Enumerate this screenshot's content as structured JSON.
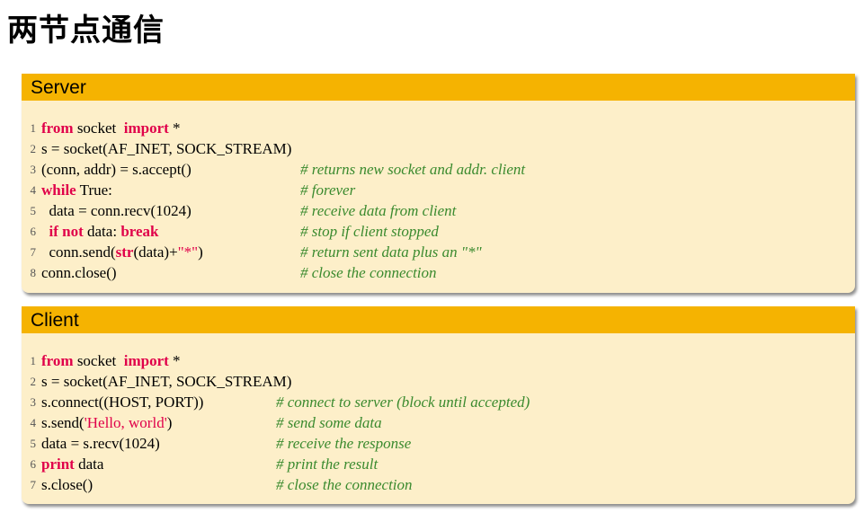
{
  "title": "两节点通信",
  "colors": {
    "header": "#f5b301",
    "body": "#fdefc9",
    "keyword": "#e0004a",
    "comment": "#3a8a2e"
  },
  "server": {
    "label": "Server",
    "lines": [
      {
        "num": "1",
        "tokens": [
          {
            "t": "from",
            "k": "kw"
          },
          {
            "t": " socket  ",
            "k": "plain"
          },
          {
            "t": "import",
            "k": "kw"
          },
          {
            "t": " *",
            "k": "plain"
          }
        ],
        "comment": ""
      },
      {
        "num": "2",
        "tokens": [
          {
            "t": "s = socket(AF_INET, SOCK_STREAM)",
            "k": "plain"
          }
        ],
        "comment": ""
      },
      {
        "num": "3",
        "tokens": [
          {
            "t": "(conn, addr) = s.accept()",
            "k": "plain"
          }
        ],
        "comment": "# returns new socket and addr. client"
      },
      {
        "num": "4",
        "tokens": [
          {
            "t": "while",
            "k": "kw"
          },
          {
            "t": " True:",
            "k": "plain"
          }
        ],
        "comment": "# forever"
      },
      {
        "num": "5",
        "tokens": [
          {
            "t": "  data = conn.recv(1024)",
            "k": "plain"
          }
        ],
        "comment": "# receive data from client"
      },
      {
        "num": "6",
        "tokens": [
          {
            "t": "  ",
            "k": "plain"
          },
          {
            "t": "if",
            "k": "kw"
          },
          {
            "t": " ",
            "k": "plain"
          },
          {
            "t": "not",
            "k": "kw"
          },
          {
            "t": " data: ",
            "k": "plain"
          },
          {
            "t": "break",
            "k": "kw"
          }
        ],
        "comment": "# stop if client stopped"
      },
      {
        "num": "7",
        "tokens": [
          {
            "t": "  conn.send(",
            "k": "plain"
          },
          {
            "t": "str",
            "k": "kw"
          },
          {
            "t": "(data)+",
            "k": "plain"
          },
          {
            "t": "\"*\"",
            "k": "str"
          },
          {
            "t": ")",
            "k": "plain"
          }
        ],
        "comment": "# return sent data plus an \"*\""
      },
      {
        "num": "8",
        "tokens": [
          {
            "t": "conn.close()",
            "k": "plain"
          }
        ],
        "comment": "# close the connection"
      }
    ]
  },
  "client": {
    "label": "Client",
    "lines": [
      {
        "num": "1",
        "tokens": [
          {
            "t": "from",
            "k": "kw"
          },
          {
            "t": " socket  ",
            "k": "plain"
          },
          {
            "t": "import",
            "k": "kw"
          },
          {
            "t": " *",
            "k": "plain"
          }
        ],
        "comment": ""
      },
      {
        "num": "2",
        "tokens": [
          {
            "t": "s = socket(AF_INET, SOCK_STREAM)",
            "k": "plain"
          }
        ],
        "comment": ""
      },
      {
        "num": "3",
        "tokens": [
          {
            "t": "s.connect((HOST, PORT))",
            "k": "plain"
          }
        ],
        "comment": "# connect to server (block until accepted)"
      },
      {
        "num": "4",
        "tokens": [
          {
            "t": "s.send(",
            "k": "plain"
          },
          {
            "t": "'Hello, world'",
            "k": "str"
          },
          {
            "t": ")",
            "k": "plain"
          }
        ],
        "comment": "# send some data"
      },
      {
        "num": "5",
        "tokens": [
          {
            "t": "data = s.recv(1024)",
            "k": "plain"
          }
        ],
        "comment": "# receive the response"
      },
      {
        "num": "6",
        "tokens": [
          {
            "t": "print",
            "k": "kw"
          },
          {
            "t": " data",
            "k": "plain"
          }
        ],
        "comment": "# print the result"
      },
      {
        "num": "7",
        "tokens": [
          {
            "t": "s.close()",
            "k": "plain"
          }
        ],
        "comment": "# close the connection"
      }
    ]
  }
}
